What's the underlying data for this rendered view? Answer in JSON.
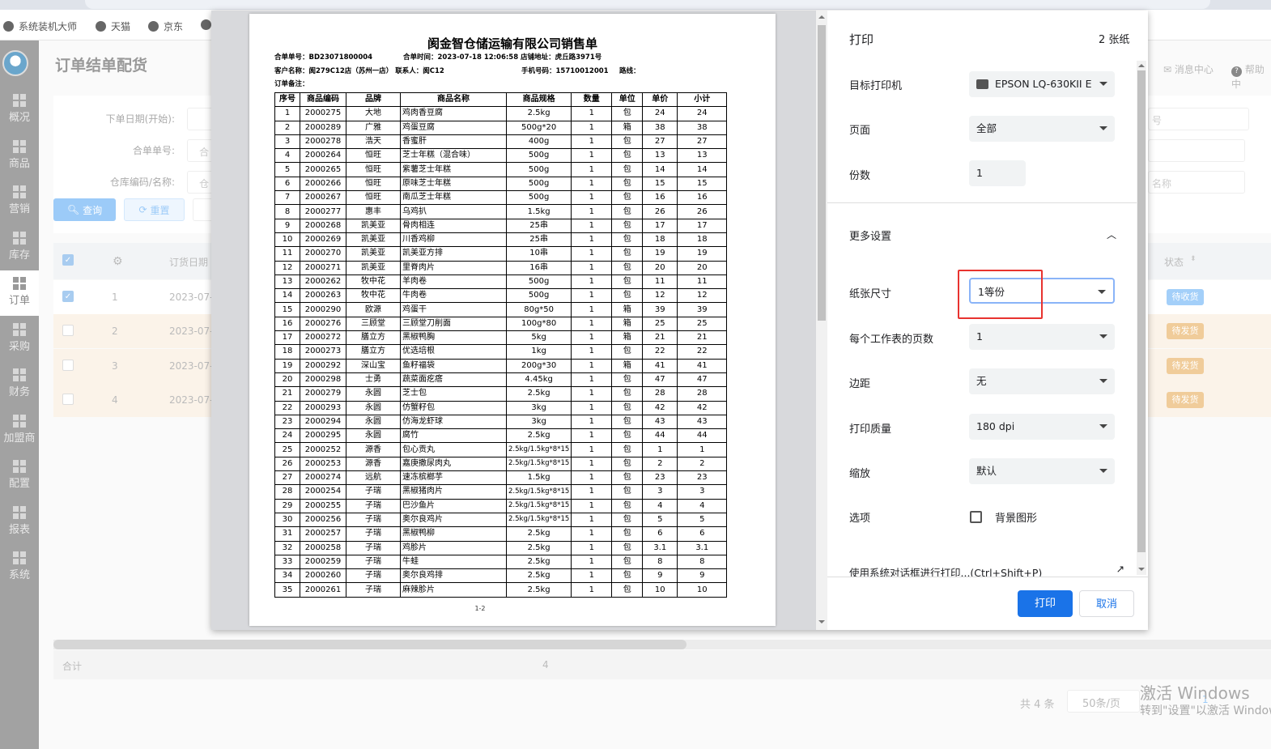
{
  "browser": {
    "bookmarks": [
      "系统装机大师",
      "天猫",
      "京东"
    ]
  },
  "sidebar": {
    "items": [
      {
        "label": "概况"
      },
      {
        "label": "商品"
      },
      {
        "label": "营销"
      },
      {
        "label": "库存"
      },
      {
        "label": "订单"
      },
      {
        "label": "采购"
      },
      {
        "label": "财务"
      },
      {
        "label": "加盟商"
      },
      {
        "label": "配置"
      },
      {
        "label": "报表"
      },
      {
        "label": "系统"
      }
    ],
    "active": "订单"
  },
  "header": {
    "title": "订单结单配货",
    "message_center": "消息中心",
    "help": "帮助中"
  },
  "filters": {
    "order_date_label": "下单日期(开始):",
    "merge_no_label": "合单单号:",
    "merge_no_placeholder": "合",
    "warehouse_label": "仓库编码/名称:",
    "warehouse_placeholder": "仓",
    "right_placeholder_1": "号",
    "right_placeholder_2": "名称",
    "query": "查询",
    "reset": "重置"
  },
  "list": {
    "col_date": "订货日期",
    "col_status": "状态",
    "rows": [
      {
        "no": "1",
        "date": "2023-07-",
        "status": "待收货",
        "checked": true
      },
      {
        "no": "2",
        "date": "2023-07-",
        "status": "待发货",
        "checked": false
      },
      {
        "no": "3",
        "date": "2023-07-",
        "status": "待发货",
        "checked": false
      },
      {
        "no": "4",
        "date": "2023-07-",
        "status": "待发货",
        "checked": false
      }
    ],
    "total_label": "合计",
    "total_value": "4",
    "count": "共 4 条",
    "page_size": "50条/页",
    "page": "1"
  },
  "watermark": {
    "line1": "激活 Windows",
    "line2": "转到\"设置\"以激活 Windows。"
  },
  "sheet": {
    "title": "阂金智仓储运输有限公司销售单",
    "merge_no": "合单单号：BD23071800004",
    "merge_time": "合单时间：2023-07-18 12:06:58 店铺地址：虎丘路3971号",
    "customer": "客户名称：阂279C12店（苏州一店） 联系人：阂C12",
    "phone": "手机号码：15710012001",
    "route": "路线：",
    "remark": "订单备注：",
    "headers": [
      "序号",
      "商品编码",
      "品牌",
      "商品名称",
      "商品规格",
      "数量",
      "单位",
      "单价",
      "小计"
    ],
    "rows": [
      [
        "1",
        "2000275",
        "大地",
        "鸡肉香豆腐",
        "2.5kg",
        "1",
        "包",
        "24",
        "24"
      ],
      [
        "2",
        "2000289",
        "广雅",
        "鸡蛋豆腐",
        "500g*20",
        "1",
        "箱",
        "38",
        "38"
      ],
      [
        "3",
        "2000278",
        "浩天",
        "香蜜肝",
        "400g",
        "1",
        "包",
        "27",
        "27"
      ],
      [
        "4",
        "2000264",
        "恒旺",
        "芝士年糕（混合味）",
        "500g",
        "1",
        "包",
        "13",
        "13"
      ],
      [
        "5",
        "2000265",
        "恒旺",
        "紫薯芝士年糕",
        "500g",
        "1",
        "包",
        "14",
        "14"
      ],
      [
        "6",
        "2000266",
        "恒旺",
        "原味芝士年糕",
        "500g",
        "1",
        "包",
        "15",
        "15"
      ],
      [
        "7",
        "2000267",
        "恒旺",
        "南瓜芝士年糕",
        "500g",
        "1",
        "包",
        "16",
        "16"
      ],
      [
        "8",
        "2000277",
        "惠丰",
        "乌鸡扒",
        "1.5kg",
        "1",
        "包",
        "26",
        "26"
      ],
      [
        "9",
        "2000268",
        "凯美亚",
        "骨肉相连",
        "25串",
        "1",
        "包",
        "17",
        "17"
      ],
      [
        "10",
        "2000269",
        "凯美亚",
        "川香鸡柳",
        "25串",
        "1",
        "包",
        "18",
        "18"
      ],
      [
        "11",
        "2000270",
        "凯美亚",
        "凯美亚方排",
        "10串",
        "1",
        "包",
        "19",
        "19"
      ],
      [
        "12",
        "2000271",
        "凯美亚",
        "里脊肉片",
        "16串",
        "1",
        "包",
        "20",
        "20"
      ],
      [
        "13",
        "2000262",
        "牧中花",
        "羊肉卷",
        "500g",
        "1",
        "包",
        "11",
        "11"
      ],
      [
        "14",
        "2000263",
        "牧中花",
        "牛肉卷",
        "500g",
        "1",
        "包",
        "12",
        "12"
      ],
      [
        "15",
        "2000290",
        "欧源",
        "鸡蛋干",
        "80g*50",
        "1",
        "箱",
        "39",
        "39"
      ],
      [
        "16",
        "2000276",
        "三顾堂",
        "三顾堂刀削面",
        "100g*80",
        "1",
        "箱",
        "25",
        "25"
      ],
      [
        "17",
        "2000272",
        "膳立方",
        "黑椒鸭胸",
        "5kg",
        "1",
        "箱",
        "21",
        "21"
      ],
      [
        "18",
        "2000273",
        "膳立方",
        "优选培根",
        "1kg",
        "1",
        "包",
        "22",
        "22"
      ],
      [
        "19",
        "2000292",
        "深山宝",
        "鱼籽福袋",
        "200g*30",
        "1",
        "箱",
        "41",
        "41"
      ],
      [
        "20",
        "2000298",
        "士勇",
        "蔬菜面疙瘩",
        "4.45kg",
        "1",
        "包",
        "47",
        "47"
      ],
      [
        "21",
        "2000279",
        "永圆",
        "芝士包",
        "2.5kg",
        "1",
        "包",
        "28",
        "28"
      ],
      [
        "22",
        "2000293",
        "永圆",
        "仿蟹籽包",
        "3kg",
        "1",
        "包",
        "42",
        "42"
      ],
      [
        "23",
        "2000294",
        "永圆",
        "仿海龙虾球",
        "3kg",
        "1",
        "包",
        "43",
        "43"
      ],
      [
        "24",
        "2000295",
        "永圆",
        "腐竹",
        "2.5kg",
        "1",
        "包",
        "44",
        "44"
      ],
      [
        "25",
        "2000252",
        "源香",
        "包心贡丸",
        "2.5kg/1.5kg*8*15",
        "1",
        "包",
        "1",
        "1"
      ],
      [
        "26",
        "2000253",
        "源香",
        "嘉庚撒尿肉丸",
        "2.5kg/1.5kg*8*15",
        "1",
        "包",
        "2",
        "2"
      ],
      [
        "27",
        "2000274",
        "远航",
        "速冻槟榔芋",
        "1.5kg",
        "1",
        "包",
        "23",
        "23"
      ],
      [
        "28",
        "2000254",
        "子瑞",
        "黑椒猪肉片",
        "2.5kg/1.5kg*8*15",
        "1",
        "包",
        "3",
        "3"
      ],
      [
        "29",
        "2000255",
        "子瑞",
        "巴沙鱼片",
        "2.5kg/1.5kg*8*15",
        "1",
        "包",
        "4",
        "4"
      ],
      [
        "30",
        "2000256",
        "子瑞",
        "奥尔良鸡片",
        "2.5kg/1.5kg*8*15",
        "1",
        "包",
        "5",
        "5"
      ],
      [
        "31",
        "2000257",
        "子瑞",
        "黑椒鸭柳",
        "2.5kg",
        "1",
        "包",
        "6",
        "6"
      ],
      [
        "32",
        "2000258",
        "子瑞",
        "鸡胗片",
        "2.5kg",
        "1",
        "包",
        "3.1",
        "3.1"
      ],
      [
        "33",
        "2000259",
        "子瑞",
        "牛蛙",
        "2.5kg",
        "1",
        "包",
        "8",
        "8"
      ],
      [
        "34",
        "2000260",
        "子瑞",
        "奥尔良鸡排",
        "2.5kg",
        "1",
        "包",
        "9",
        "9"
      ],
      [
        "35",
        "2000261",
        "子瑞",
        "麻辣胗片",
        "2.5kg",
        "1",
        "包",
        "10",
        "10"
      ]
    ],
    "page_number": "1-2"
  },
  "print": {
    "title": "打印",
    "sheets": "2 张纸",
    "printer_label": "目标打印机",
    "printer": "EPSON LQ-630KII E",
    "pages_label": "页面",
    "pages": "全部",
    "copies_label": "份数",
    "copies": "1",
    "more_settings": "更多设置",
    "paper_label": "纸张尺寸",
    "paper": "1等份",
    "per_sheet_label": "每个工作表的页数",
    "per_sheet": "1",
    "margins_label": "边距",
    "margins": "无",
    "quality_label": "打印质量",
    "quality": "180 dpi",
    "scale_label": "缩放",
    "scale": "默认",
    "options_label": "选项",
    "background_graphics": "背景图形",
    "system_dialog": "使用系统对话框进行打印...(Ctrl+Shift+P)",
    "print_button": "打印",
    "cancel_button": "取消",
    "accent": "#1a73e8"
  }
}
